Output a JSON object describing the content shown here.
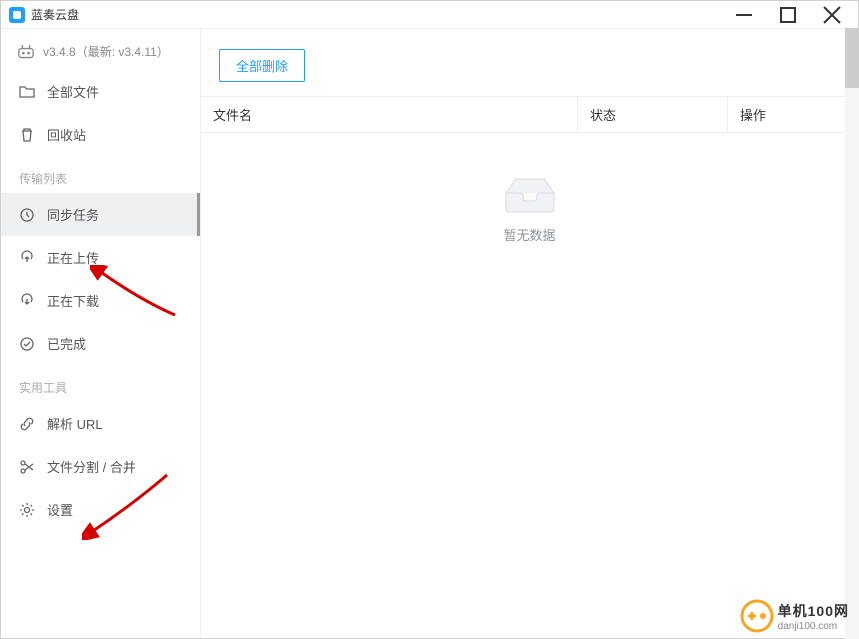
{
  "window": {
    "title": "蓝奏云盘"
  },
  "sidebar": {
    "version": "v3.4.8（最新: v3.4.11）",
    "items": {
      "all_files": "全部文件",
      "recycle": "回收站",
      "sync": "同步任务",
      "uploading": "正在上传",
      "downloading": "正在下载",
      "completed": "已完成",
      "parse_url": "解析 URL",
      "split_merge": "文件分割 / 合并",
      "settings": "设置"
    },
    "sections": {
      "transfer": "传输列表",
      "tools": "实用工具"
    }
  },
  "toolbar": {
    "delete_all": "全部删除"
  },
  "table": {
    "columns": {
      "name": "文件名",
      "status": "状态",
      "action": "操作"
    }
  },
  "empty": {
    "text": "暂无数据"
  },
  "watermark": {
    "line1": "单机100网",
    "line2": "danji100.com"
  }
}
